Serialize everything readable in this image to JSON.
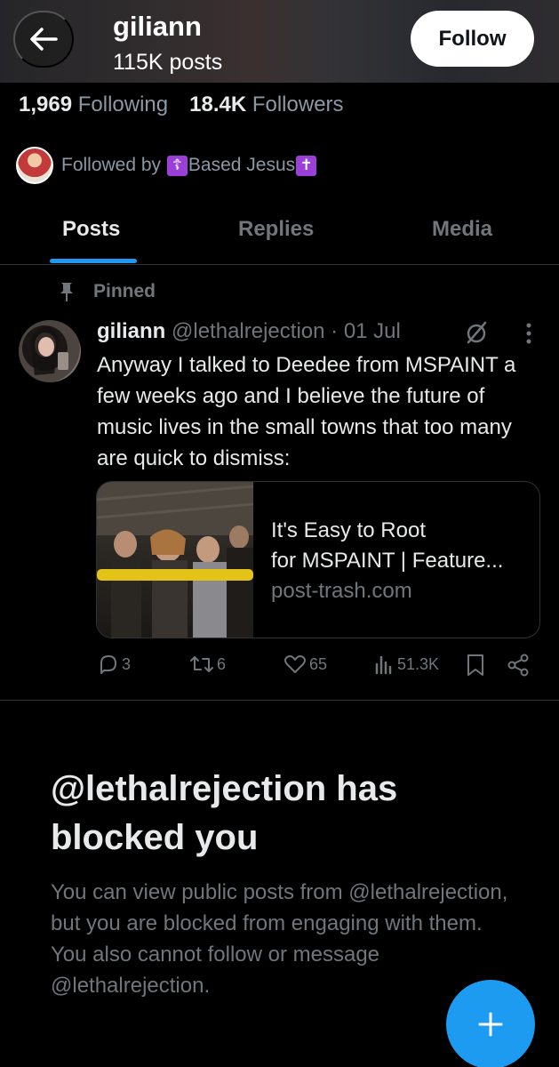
{
  "header": {
    "name": "giliann",
    "posts_count": "115K posts",
    "follow_label": "Follow"
  },
  "stats": {
    "following_count": "1,969",
    "following_label": "Following",
    "followers_count": "18.4K",
    "followers_label": "Followers"
  },
  "followed_by": {
    "prefix": "Followed by",
    "cross_left": "☦",
    "name": "Based Jesus",
    "cross_right": "✝"
  },
  "tabs": [
    {
      "label": "Posts",
      "active": true
    },
    {
      "label": "Replies",
      "active": false
    },
    {
      "label": "Media",
      "active": false
    }
  ],
  "pinned_post": {
    "pinned_label": "Pinned",
    "author": "giliann",
    "handle": "@lethalrejection",
    "separator": "·",
    "date": "01 Jul",
    "text": "Anyway I talked to Deedee from MSPAINT a few weeks ago and I believe the future of music lives in the small towns that too many are quick to dismiss:",
    "card": {
      "title_line1": "It's Easy to Root",
      "title_line2": "for MSPAINT | Feature...",
      "domain": "post-trash.com"
    },
    "actions": {
      "replies": "3",
      "reposts": "6",
      "likes": "65",
      "views": "51.3K"
    }
  },
  "blocked": {
    "title": "@lethalrejection has blocked you",
    "description": "You can view public posts from @lethalrejection, but you are blocked from engaging with them. You also cannot follow or message @lethalrejection."
  },
  "colors": {
    "accent": "#1d9bf0",
    "muted_text": "#71767b",
    "primary_text": "#e7e9ea",
    "background": "#000000",
    "border": "#2f3336",
    "badge_purple": "#9b3fd8"
  },
  "icons": {
    "back": "arrow-left-icon",
    "pin": "pin-icon",
    "edit": "edit-off-icon",
    "more": "more-vertical-icon",
    "reply": "reply-icon",
    "repost": "repost-icon",
    "like": "heart-icon",
    "views": "views-icon",
    "bookmark": "bookmark-icon",
    "share": "share-icon",
    "compose": "plus-icon"
  }
}
